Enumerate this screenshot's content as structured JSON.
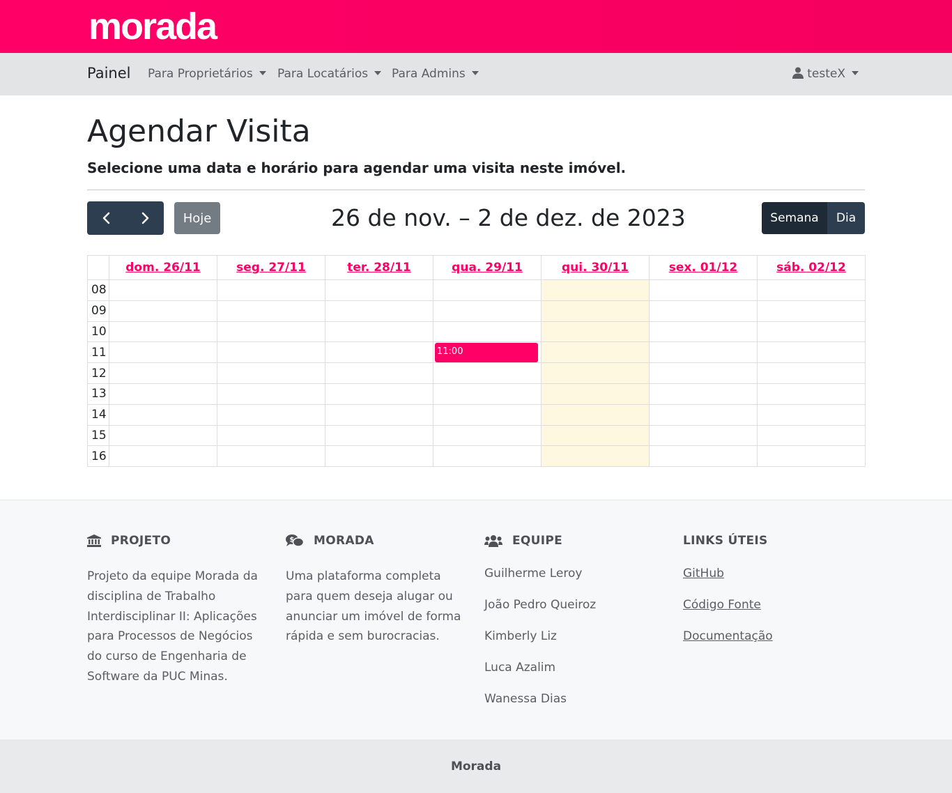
{
  "brand": {
    "name": "morada",
    "color": "#ff0066"
  },
  "nav": {
    "home": "Painel",
    "items": [
      "Para Proprietários",
      "Para Locatários",
      "Para Admins"
    ],
    "user": "testeX"
  },
  "page": {
    "title": "Agendar Visita",
    "subtitle": "Selecione uma data e horário para agendar uma visita neste imóvel."
  },
  "calendar": {
    "today_label": "Hoje",
    "range_title": "26 de nov. – 2 de dez. de 2023",
    "views": {
      "week": "Semana",
      "day": "Dia",
      "active": "Semana"
    },
    "days": [
      "dom. 26/11",
      "seg. 27/11",
      "ter. 28/11",
      "qua. 29/11",
      "qui. 30/11",
      "sex. 01/12",
      "sáb. 02/12"
    ],
    "today": "qui. 30/11",
    "hours": [
      "08",
      "09",
      "10",
      "11",
      "12",
      "13",
      "14",
      "15",
      "16"
    ],
    "events": [
      {
        "day": "qua. 29/11",
        "hour": "11",
        "label": "11:00",
        "color": "#ff0066"
      }
    ]
  },
  "footer": {
    "projeto": {
      "title": "PROJETO",
      "text": "Projeto da equipe Morada da disciplina de Trabalho Interdisciplinar II: Aplicações para Processos de Negócios do curso de Engenharia de Software da PUC Minas."
    },
    "morada": {
      "title": "MORADA",
      "text": "Uma plataforma completa para quem deseja alugar ou anunciar um imóvel de forma rápida e sem burocracias."
    },
    "equipe": {
      "title": "EQUIPE",
      "members": [
        "Guilherme Leroy",
        "João Pedro Queiroz",
        "Kimberly Liz",
        "Luca Azalim",
        "Wanessa Dias"
      ]
    },
    "links": {
      "title": "LINKS ÚTEIS",
      "items": [
        "GitHub",
        "Código Fonte",
        "Documentação"
      ]
    },
    "bottom": "Morada"
  }
}
